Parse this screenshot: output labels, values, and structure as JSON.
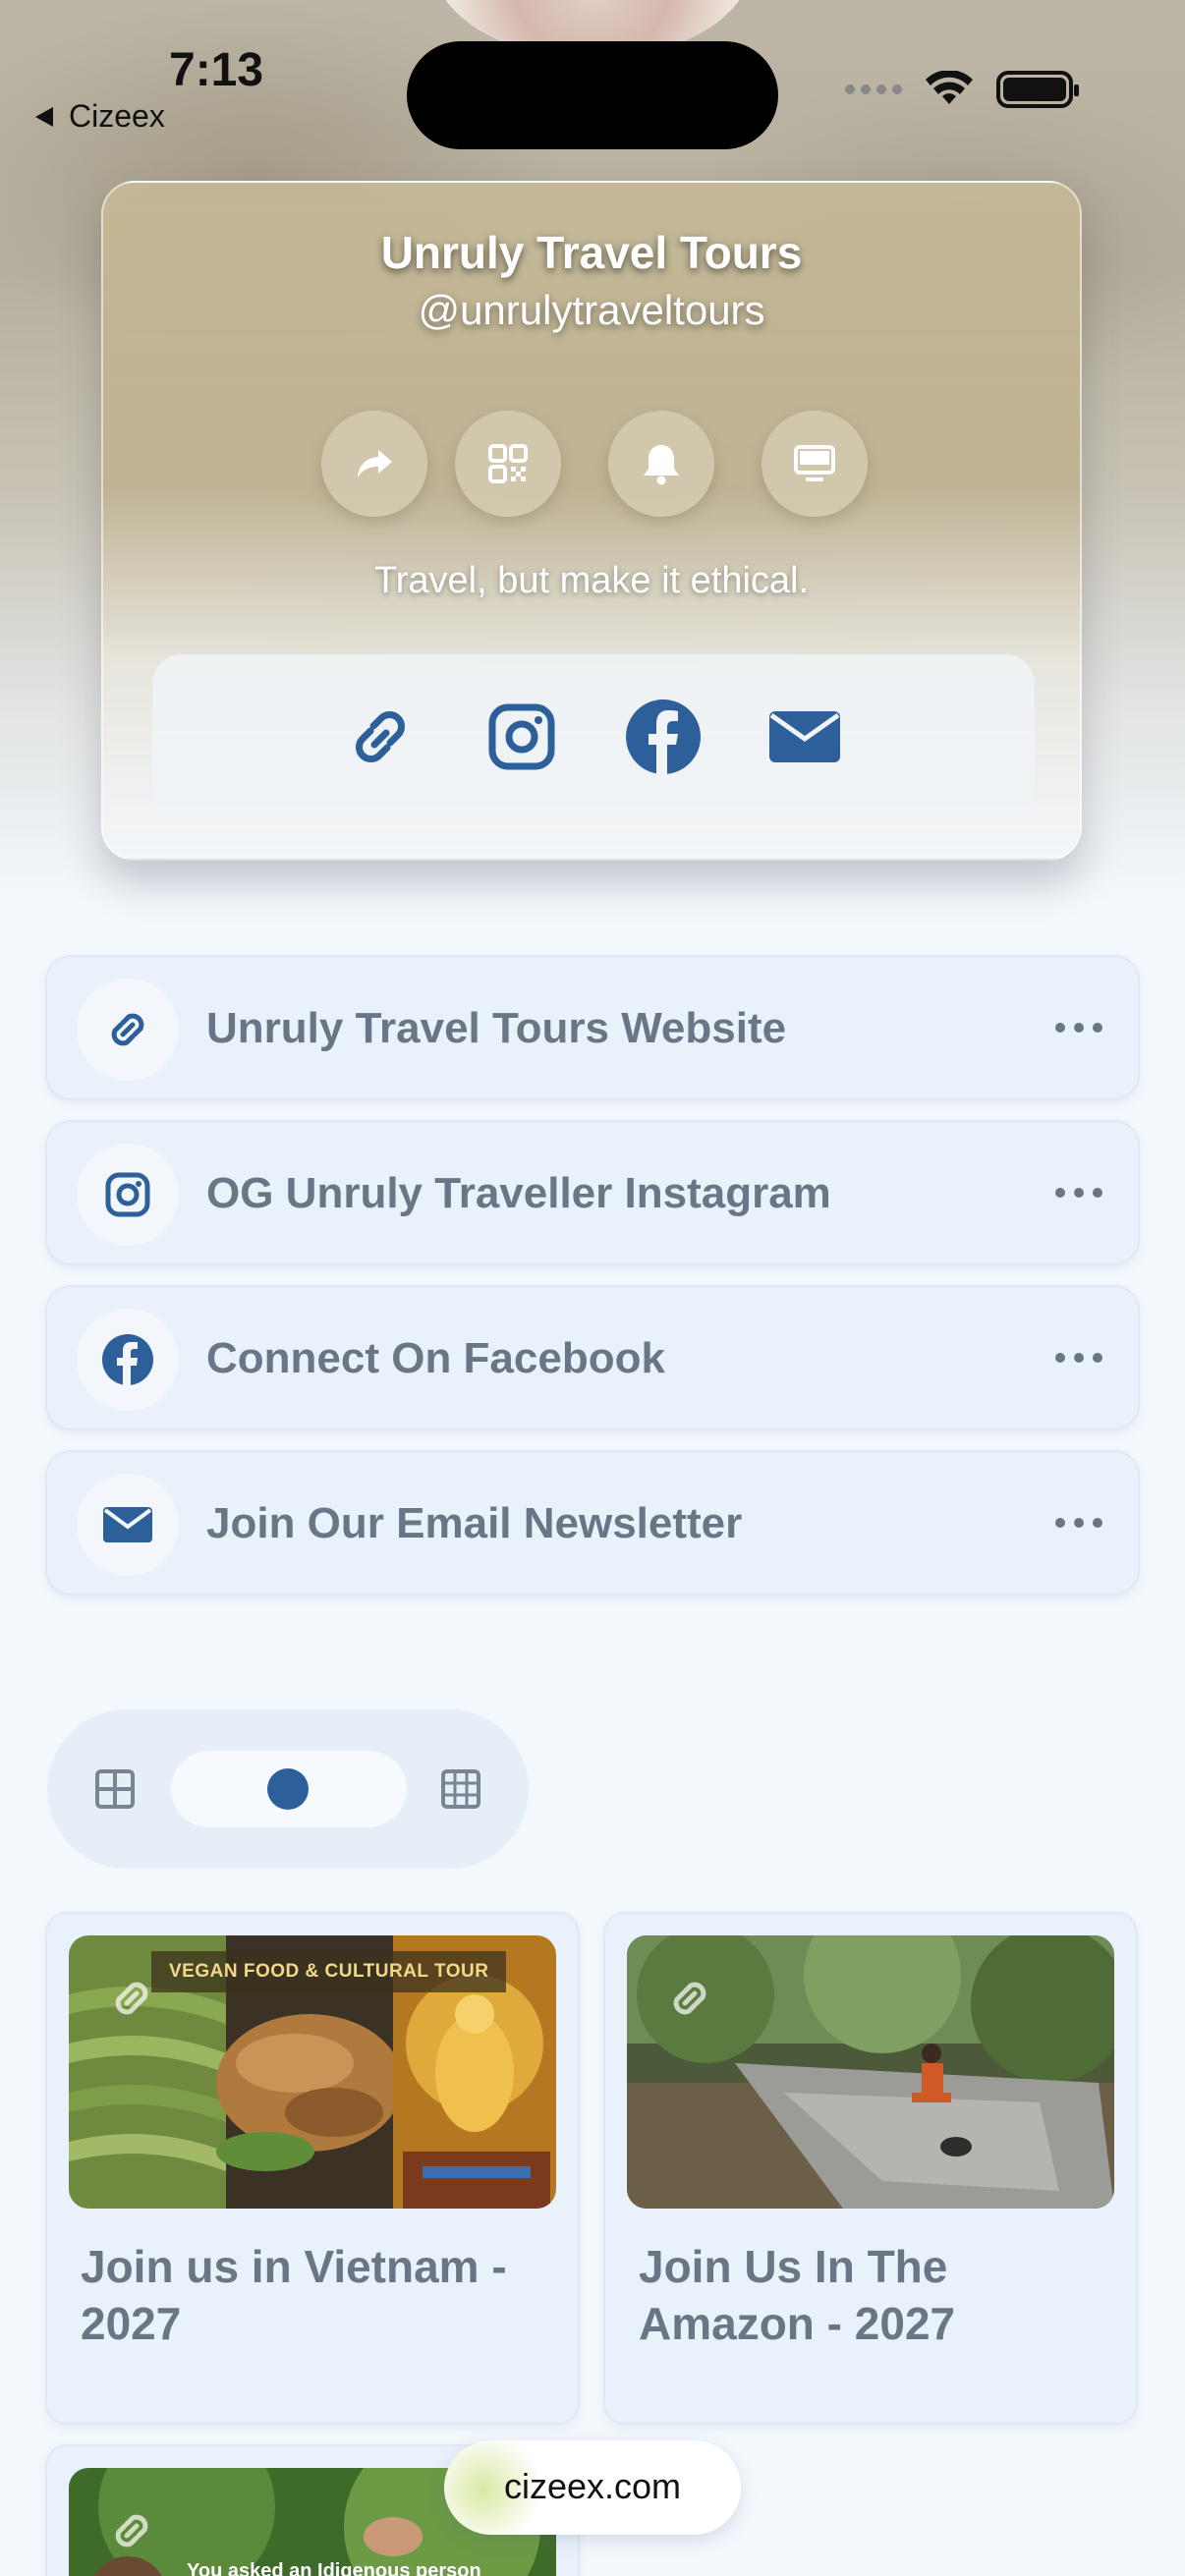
{
  "status_bar": {
    "time": "7:13",
    "back_app": "Cizeex"
  },
  "profile": {
    "name": "Unruly Travel Tours",
    "handle": "@unrulytraveltours",
    "bio": "Travel, but make it ethical.",
    "actions": [
      "share-icon",
      "qr-code-icon",
      "bell-icon",
      "monitor-icon"
    ],
    "socials": [
      "link-icon",
      "instagram-icon",
      "facebook-icon",
      "envelope-icon"
    ]
  },
  "links": [
    {
      "label": "Unruly Travel Tours Website",
      "icon": "link-icon"
    },
    {
      "label": "OG Unruly Traveller Instagram",
      "icon": "instagram-icon"
    },
    {
      "label": "Connect On Facebook",
      "icon": "facebook-icon"
    },
    {
      "label": "Join Our Email Newsletter",
      "icon": "envelope-icon"
    }
  ],
  "view_toggle": {
    "left_icon": "grid-2x2-icon",
    "right_icon": "grid-3x3-icon"
  },
  "cards": [
    {
      "title": "Join us in Vietnam - 2027",
      "banner": "VEGAN FOOD & CULTURAL TOUR"
    },
    {
      "title": "Join Us In The Amazon - 2027"
    },
    {
      "caption": "You asked an Idigenous person"
    }
  ],
  "footer": {
    "domain": "cizeex.com"
  },
  "colors": {
    "accent": "#2d5f9a",
    "link_bg": "#e9f1fb",
    "text_muted": "#6b7586",
    "page_bg": "#f3f8fd"
  }
}
